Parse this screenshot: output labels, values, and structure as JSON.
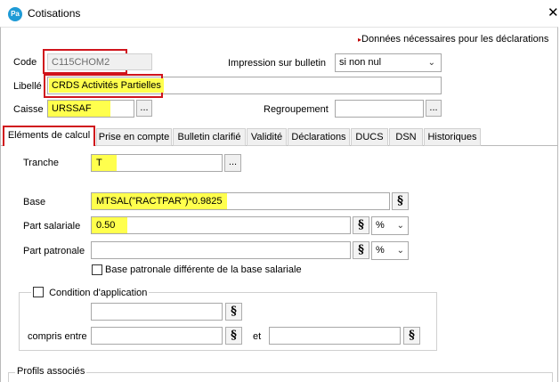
{
  "window": {
    "app_icon_text": "Pa",
    "title": "Cotisations",
    "close_symbol": "✕"
  },
  "note": {
    "arrow": "▸",
    "text": "Données nécessaires pour les déclarations"
  },
  "fields": {
    "code": {
      "label": "Code",
      "value": "C115CHOM2"
    },
    "libelle": {
      "label": "Libellé",
      "value": "CRDS Activités Partielles"
    },
    "caisse": {
      "label": "Caisse",
      "value": "URSSAF",
      "button": "..."
    },
    "impression": {
      "label": "Impression sur bulletin",
      "value": "si non nul"
    },
    "regroupement": {
      "label": "Regroupement",
      "value": "",
      "button": "..."
    }
  },
  "tabs": [
    {
      "label": "Eléments de calcul"
    },
    {
      "label": "Prise en compte"
    },
    {
      "label": "Bulletin clarifié"
    },
    {
      "label": "Validité"
    },
    {
      "label": "Déclarations"
    },
    {
      "label": "DUCS"
    },
    {
      "label": "DSN"
    },
    {
      "label": "Historiques"
    }
  ],
  "calc": {
    "tranche": {
      "label": "Tranche",
      "value": "T",
      "button": "..."
    },
    "base": {
      "label": "Base",
      "value": "MTSAL(\"RACTPAR\")*0.9825",
      "button": "§"
    },
    "part_salariale": {
      "label": "Part salariale",
      "value": "0.50",
      "button": "§",
      "unit": "%"
    },
    "part_patronale": {
      "label": "Part patronale",
      "value": "",
      "button": "§",
      "unit": "%"
    },
    "base_patronale_checkbox": {
      "label": "Base patronale différente de la base salariale"
    },
    "condition": {
      "legend": "Condition d'application",
      "value": "",
      "button": "§",
      "compris_entre_label": "compris entre",
      "et_label": "et",
      "min_value": "",
      "max_value": "",
      "min_button": "§",
      "max_button": "§"
    },
    "profils": {
      "legend": "Profils associés"
    }
  },
  "colors": {
    "highlight": "#ffff4d",
    "annotation_red": "#d0141c",
    "accent": "#1f9bd6"
  }
}
